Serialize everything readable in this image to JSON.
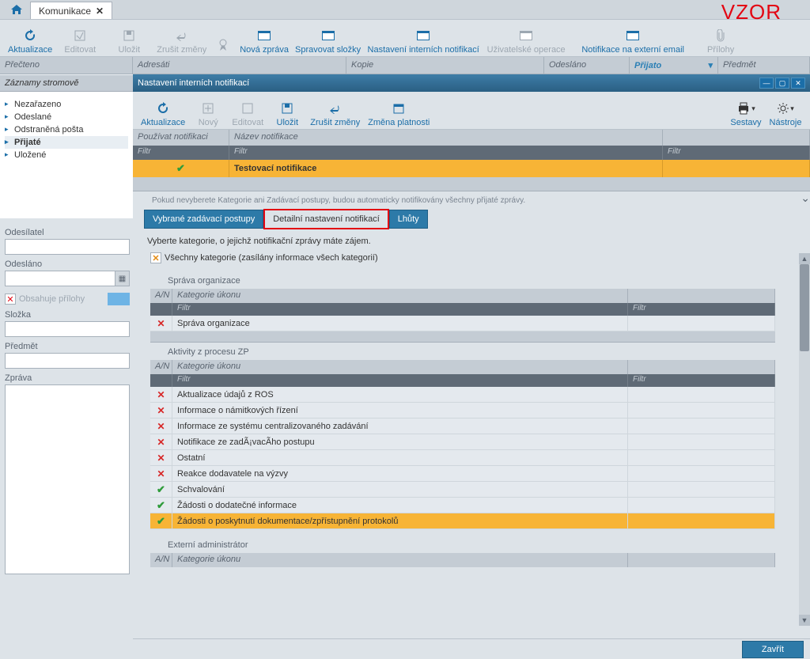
{
  "tab": {
    "title": "Komunikace"
  },
  "watermark": "VZOR",
  "toolbar": {
    "update": "Aktualizace",
    "edit": "Editovat",
    "save": "Uložit",
    "cancel": "Zrušit změny",
    "medal": "",
    "new_msg": "Nová zpráva",
    "manage_folders": "Spravovat složky",
    "internal_notif": "Nastavení interních notifikací",
    "user_ops": "Uživatelské operace",
    "ext_email": "Notifikace na externí email",
    "attachments": "Přílohy"
  },
  "gridhdr": {
    "read": "Přečteno",
    "recipients": "Adresáti",
    "copy": "Kopie",
    "sent": "Odesláno",
    "received": "Přijato",
    "subject": "Předmět"
  },
  "tree": {
    "title": "Záznamy stromově",
    "items": [
      "Nezařazeno",
      "Odeslané",
      "Odstraněná pošta",
      "Přijaté",
      "Uložené"
    ],
    "selected": 3
  },
  "side": {
    "sender": "Odesílatel",
    "sent": "Odesláno",
    "has_attachments": "Obsahuje přílohy",
    "folder": "Složka",
    "subject": "Předmět",
    "message": "Zpráva"
  },
  "panel": {
    "title": "Nastavení interních notifikací"
  },
  "innerbar": {
    "update": "Aktualizace",
    "new": "Nový",
    "edit": "Editovat",
    "save": "Uložit",
    "cancel": "Zrušit změny",
    "validity": "Změna platnosti",
    "reports": "Sestavy",
    "tools": "Nástroje"
  },
  "notif_grid": {
    "col_use": "Používat notifikaci",
    "col_name": "Název notifikace",
    "filter": "Filtr",
    "row_name": "Testovací notifikace"
  },
  "hint": "Pokud nevyberete Kategorie ani Zadávací postupy, budou automaticky notifikovány všechny přijaté zprávy.",
  "tabs": {
    "t1": "Vybrané zadávací postupy",
    "t2": "Detailní nastavení notifikací",
    "t3": "Lhůty"
  },
  "cat": {
    "prompt": "Vyberte kategorie, o jejichž notifikační zprávy máte zájem.",
    "all": "Všechny kategorie (zasílány informace všech kategorií)",
    "col_an": "A/N",
    "col_name": "Kategorie úkonu",
    "filter": "Filtr",
    "section1": {
      "title": "Správa organizace",
      "rows": [
        {
          "on": false,
          "name": "Správa organizace",
          "selected": false
        }
      ]
    },
    "section2": {
      "title": "Aktivity z procesu ZP",
      "rows": [
        {
          "on": false,
          "name": "Aktualizace údajů z ROS"
        },
        {
          "on": false,
          "name": "Informace o námitkových řízení"
        },
        {
          "on": false,
          "name": "Informace ze systému centralizovaného zadávání"
        },
        {
          "on": false,
          "name": "Notifikace ze zadÃ¡vacÃ­ho postupu"
        },
        {
          "on": false,
          "name": "Ostatní"
        },
        {
          "on": false,
          "name": "Reakce dodavatele na výzvy"
        },
        {
          "on": true,
          "name": "Schvalování"
        },
        {
          "on": true,
          "name": "Žádosti o dodatečné informace"
        },
        {
          "on": true,
          "name": "Žádosti o poskytnutí dokumentace/zpřístupnění protokolů",
          "selected": true
        }
      ]
    },
    "section3": {
      "title": "Externí administrátor"
    }
  },
  "footer": {
    "close": "Zavřít"
  }
}
